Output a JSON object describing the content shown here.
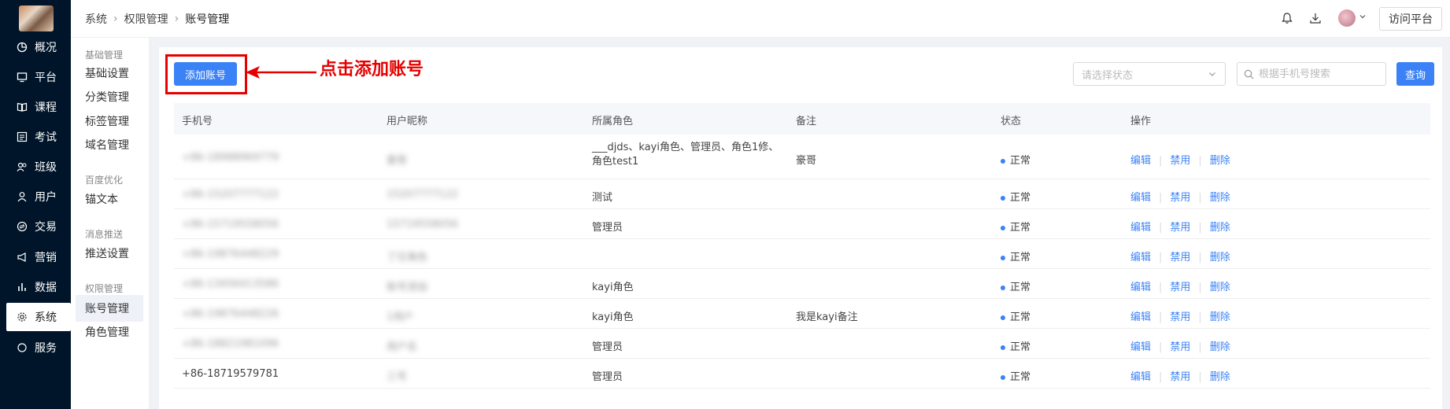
{
  "breadcrumb": [
    "系统",
    "权限管理",
    "账号管理"
  ],
  "header": {
    "visit_label": "访问平台"
  },
  "nav": [
    {
      "label": "概况",
      "icon": "pie-chart-icon"
    },
    {
      "label": "平台",
      "icon": "monitor-icon"
    },
    {
      "label": "课程",
      "icon": "book-icon"
    },
    {
      "label": "考试",
      "icon": "exam-icon"
    },
    {
      "label": "班级",
      "icon": "group-icon"
    },
    {
      "label": "用户",
      "icon": "user-icon"
    },
    {
      "label": "交易",
      "icon": "trade-icon"
    },
    {
      "label": "营销",
      "icon": "megaphone-icon"
    },
    {
      "label": "数据",
      "icon": "bar-chart-icon"
    },
    {
      "label": "系统",
      "icon": "gear-icon",
      "active": true
    },
    {
      "label": "服务",
      "icon": "service-icon"
    }
  ],
  "submenu": {
    "groups": [
      {
        "title": "基础管理",
        "items": [
          "基础设置",
          "分类管理",
          "标签管理",
          "域名管理"
        ]
      },
      {
        "title": "百度优化",
        "items": [
          "锚文本"
        ]
      },
      {
        "title": "消息推送",
        "items": [
          "推送设置"
        ]
      },
      {
        "title": "权限管理",
        "items": [
          "账号管理",
          "角色管理"
        ]
      }
    ],
    "active": "账号管理"
  },
  "toolbar": {
    "add_label": "添加账号",
    "annotation": "点击添加账号",
    "status_placeholder": "请选择状态",
    "search_placeholder": "根据手机号搜索",
    "query_label": "查询"
  },
  "table": {
    "columns": [
      "手机号",
      "用户昵称",
      "所属角色",
      "备注",
      "状态",
      "操作"
    ],
    "actions": [
      "编辑",
      "禁用",
      "删除"
    ],
    "rows": [
      {
        "phone": "+86-18988969779",
        "nickname": "豪哥",
        "role": "___djds、kayi角色、管理员、角色1修、角色test1",
        "remark": "豪哥",
        "status": "正常"
      },
      {
        "phone": "+86-15207777122",
        "nickname": "15207777122",
        "role": "测试",
        "remark": "",
        "status": "正常"
      },
      {
        "phone": "+86-15719558056",
        "nickname": "15719558056",
        "role": "管理员",
        "remark": "",
        "status": "正常"
      },
      {
        "phone": "+86-19876448229",
        "nickname": "了位角色",
        "role": "",
        "remark": "",
        "status": "正常"
      },
      {
        "phone": "+86-13456413586",
        "nickname": "账号添加",
        "role": "kayi角色",
        "remark": "",
        "status": "正常"
      },
      {
        "phone": "+86-19876448226",
        "nickname": "1用户",
        "role": "kayi角色",
        "remark": "我是kayi备注",
        "status": "正常"
      },
      {
        "phone": "+86-18821981096",
        "nickname": "用户名",
        "role": "管理员",
        "remark": "",
        "status": "正常"
      },
      {
        "phone": "+86-18719579781",
        "nickname": "三号",
        "role": "管理员",
        "remark": "",
        "status": "正常"
      }
    ]
  },
  "colors": {
    "primary": "#3b82f6",
    "sidebar": "#001529",
    "annotation": "#e60000"
  }
}
